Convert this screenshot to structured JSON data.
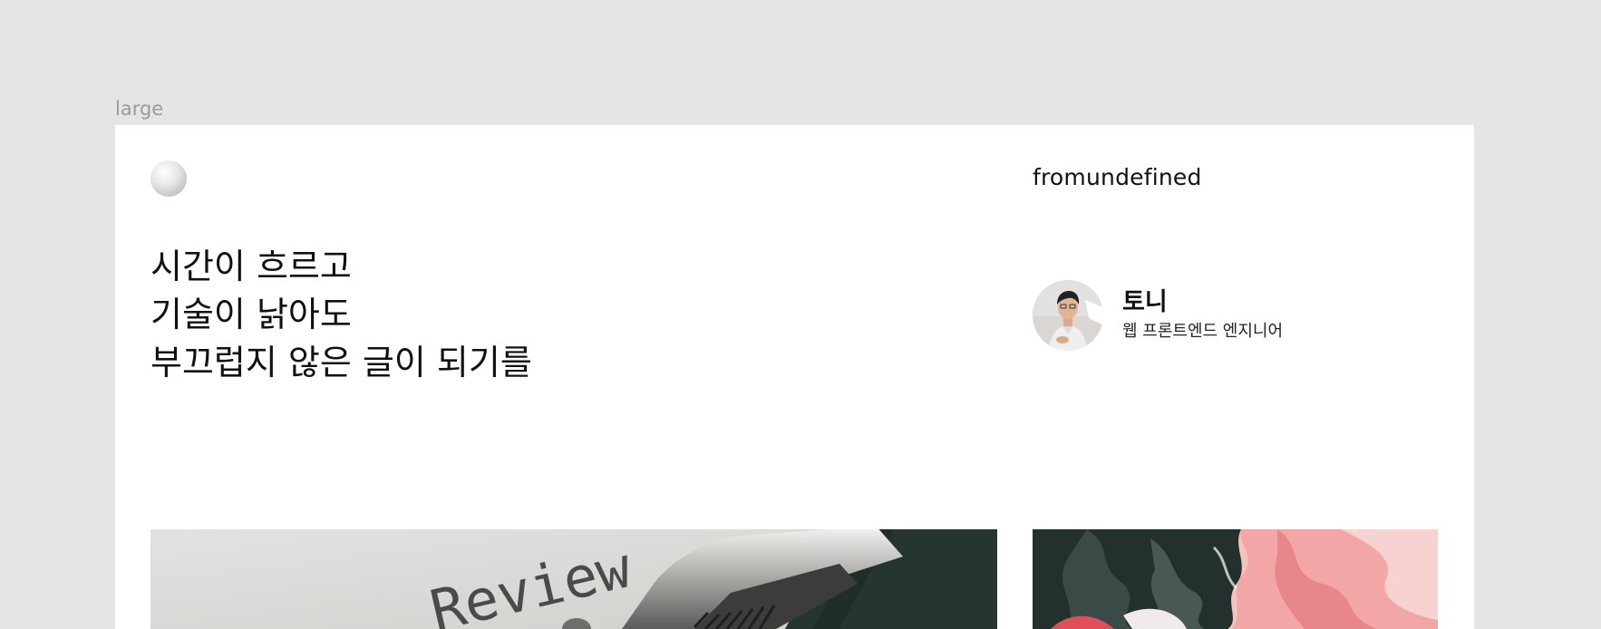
{
  "canvas": {
    "frame_label": "large"
  },
  "header": {
    "logo_icon": "sphere-logo-icon",
    "site_name": "fromundefined"
  },
  "hero": {
    "lines": [
      "시간이 흐르고",
      "기술이 낡아도",
      "부끄럽지 않은 글이 되기를"
    ]
  },
  "profile": {
    "name": "토니",
    "role": "웹 프론트엔드 엔지니어",
    "avatar_icon": "profile-photo"
  },
  "posts": {
    "left_image_text": "Review",
    "left_image_icon": "typewriter-review-photo",
    "right_image_icon": "abstract-paint-photo"
  },
  "colors": {
    "canvas_bg": "#e5e5e5",
    "frame_bg": "#ffffff",
    "text": "#111111",
    "label": "#9a9a9a"
  }
}
